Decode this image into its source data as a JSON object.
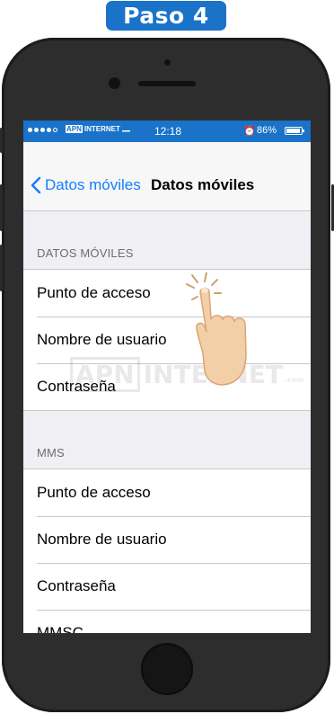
{
  "badge": {
    "text": "Paso 4",
    "color": "#1a73c9"
  },
  "statusbar": {
    "carrier_apn": "APN",
    "carrier_name": "INTERNET",
    "time": "12:18",
    "alarm_icon": "alarm-clock-icon",
    "battery_percent": "86%",
    "background": "#1a73c9"
  },
  "navbar": {
    "back_label": "Datos móviles",
    "title": "Datos móviles",
    "accent": "#157efb"
  },
  "sections": [
    {
      "header": "DATOS MÓVILES",
      "rows": [
        "Punto de acceso",
        "Nombre de usuario",
        "Contraseña"
      ]
    },
    {
      "header": "MMS",
      "rows": [
        "Punto de acceso",
        "Nombre de usuario",
        "Contraseña",
        "MMSC"
      ]
    }
  ],
  "watermark": {
    "box": "APN",
    "text": "INTERNET",
    "suffix": ".com"
  }
}
